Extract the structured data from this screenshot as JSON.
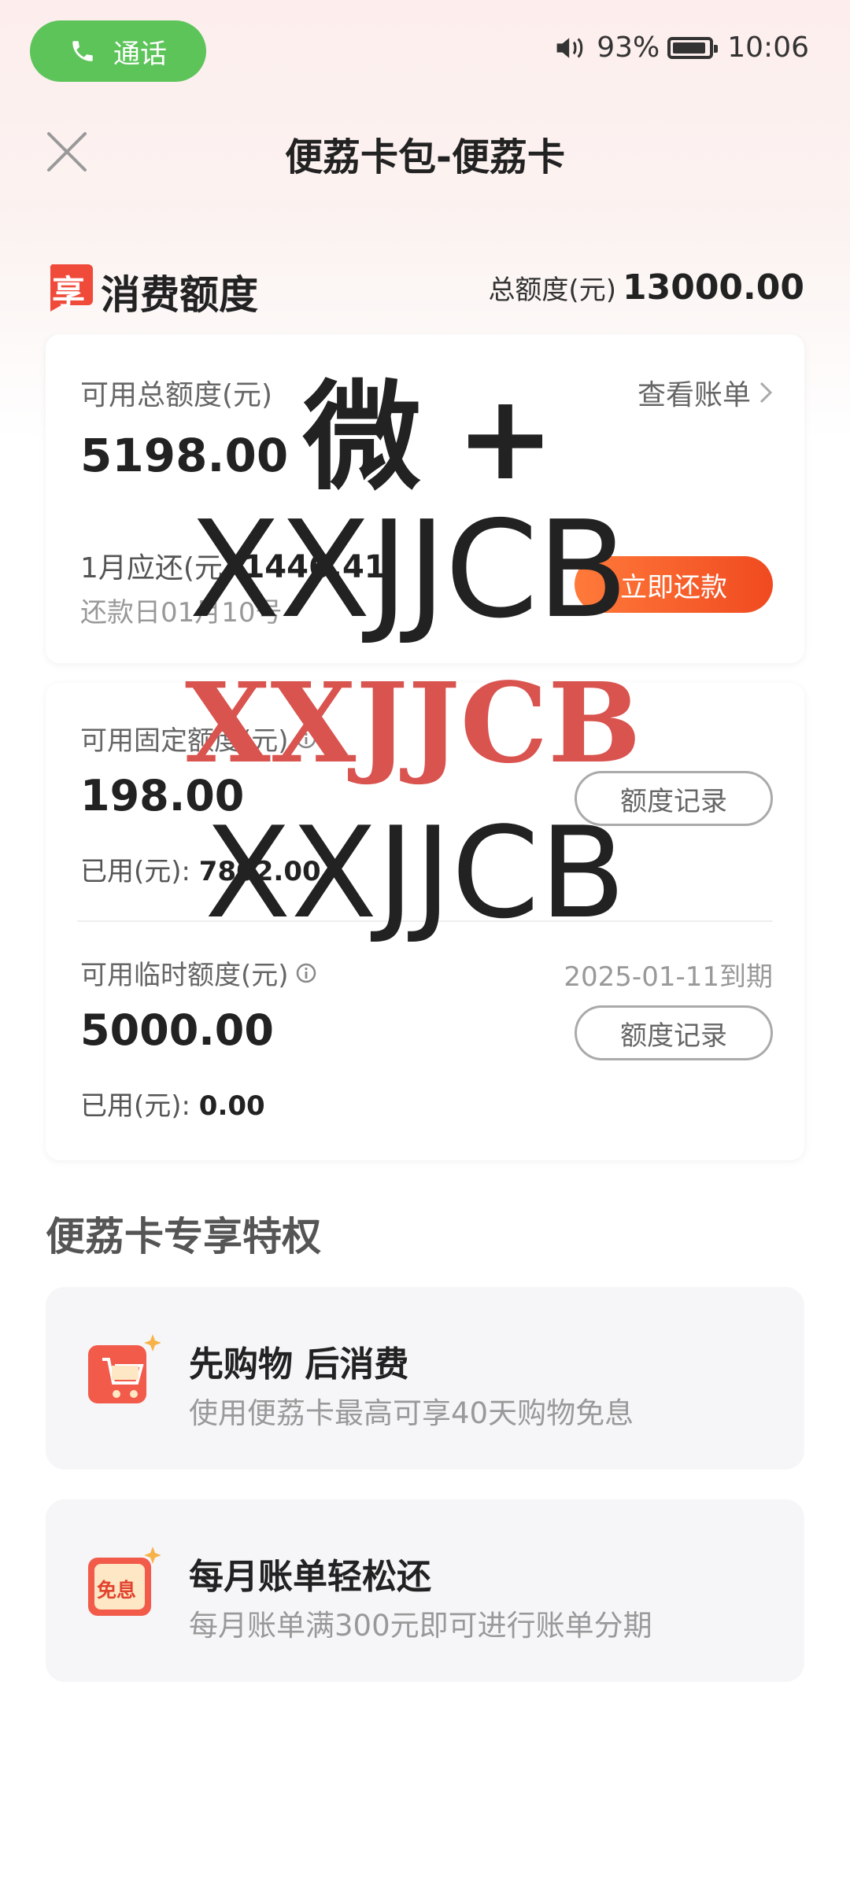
{
  "status": {
    "call_label": "通话",
    "battery": "93%",
    "battery_level": 0.93,
    "time": "10:06"
  },
  "header": {
    "title": "便荔卡包-便荔卡"
  },
  "section": {
    "icon_char": "享",
    "title": "消费额度",
    "total_label": "总额度(元)",
    "total_value": "13000.00"
  },
  "card1": {
    "label": "可用总额度(元)",
    "value": "5198.00",
    "bill_link": "查看账单",
    "due_label": "1月应还(元)",
    "due_value": "1446.41",
    "due_date": "还款日01月10号",
    "repay_button": "立即还款"
  },
  "card2": {
    "fixed_label": "可用固定额度(元)",
    "fixed_value": "198.00",
    "fixed_used_label": "已用(元):",
    "fixed_used_value": "7802.00",
    "fixed_record_button": "额度记录",
    "temp_label": "可用临时额度(元)",
    "temp_expiry": "2025-01-11到期",
    "temp_value": "5000.00",
    "temp_used_label": "已用(元):",
    "temp_used_value": "0.00",
    "temp_record_button": "额度记录"
  },
  "privileges": {
    "title": "便荔卡专享特权",
    "items": [
      {
        "title": "先购物 后消费",
        "subtitle": "使用便荔卡最高可享40天购物免息"
      },
      {
        "title": "每月账单轻松还",
        "subtitle": "每月账单满300元即可进行账单分期",
        "badge": "免息"
      }
    ]
  },
  "watermark": {
    "line1": "微 +",
    "line2": "XXJJCB",
    "line3": "XXJJCB",
    "line4": "XXJJCB"
  }
}
